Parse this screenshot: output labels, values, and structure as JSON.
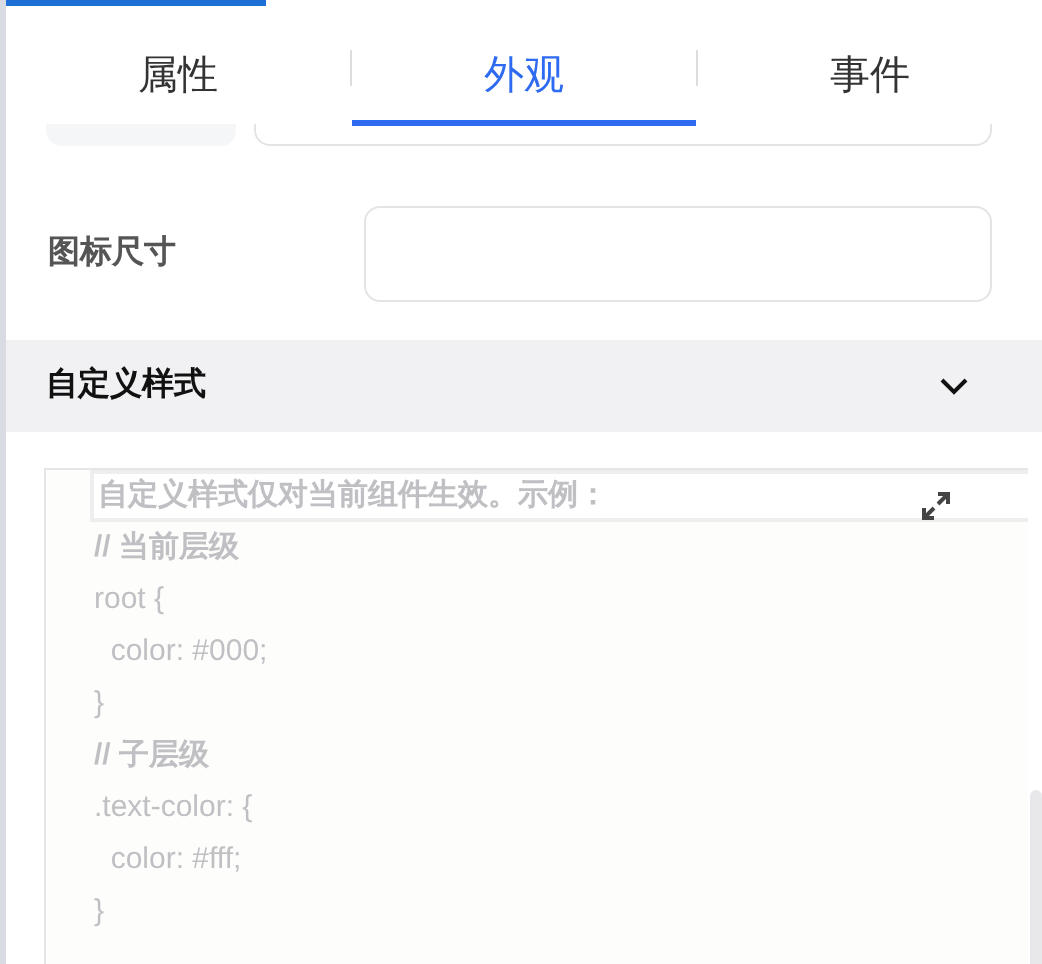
{
  "tabs": [
    {
      "label": "属性",
      "selected": false
    },
    {
      "label": "外观",
      "selected": true
    },
    {
      "label": "事件",
      "selected": false
    }
  ],
  "icon_size": {
    "label": "图标尺寸"
  },
  "section": {
    "title": "自定义样式",
    "expanded": true
  },
  "editor": {
    "placeholder_lines": [
      "自定义样式仅对当前组件生效。示例：",
      "// 当前层级",
      "root {",
      "  color: #000;",
      "}",
      "// 子层级",
      ".text-color: {",
      "  color: #fff;",
      "}"
    ]
  }
}
